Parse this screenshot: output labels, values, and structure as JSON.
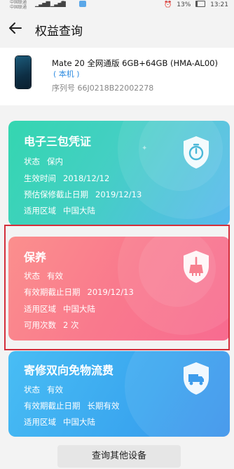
{
  "status_bar": {
    "carrier_1": "中国联通",
    "carrier_2": "中国联通",
    "battery": "13%",
    "time": "13:21"
  },
  "header": {
    "title": "权益查询"
  },
  "device": {
    "name": "Mate 20 全网通版 6GB+64GB (HMA-AL00)",
    "tag": "( 本机 )",
    "serial_label": "序列号",
    "serial": "66J0218B22002278"
  },
  "cards": [
    {
      "title": "电子三包凭证",
      "icon": "stopwatch-shield-icon",
      "rows": [
        {
          "label": "状态",
          "value": "保内"
        },
        {
          "label": "生效时间",
          "value": "2018/12/12"
        },
        {
          "label": "预估保修截止日期",
          "value": "2019/12/13"
        },
        {
          "label": "适用区域",
          "value": "中国大陆"
        }
      ]
    },
    {
      "title": "保养",
      "icon": "broom-shield-icon",
      "rows": [
        {
          "label": "状态",
          "value": "有效"
        },
        {
          "label": "有效期截止日期",
          "value": "2019/12/13"
        },
        {
          "label": "适用区域",
          "value": "中国大陆"
        },
        {
          "label": "可用次数",
          "value": "2 次"
        }
      ]
    },
    {
      "title": "寄修双向免物流费",
      "icon": "truck-shield-icon",
      "rows": [
        {
          "label": "状态",
          "value": "有效"
        },
        {
          "label": "有效期截止日期",
          "value": "长期有效"
        },
        {
          "label": "适用区域",
          "value": "中国大陆"
        }
      ]
    }
  ],
  "footer": {
    "button_label": "查询其他设备"
  },
  "colors": {
    "highlight_border": "#d32f3b",
    "link": "#2f8ce0"
  }
}
